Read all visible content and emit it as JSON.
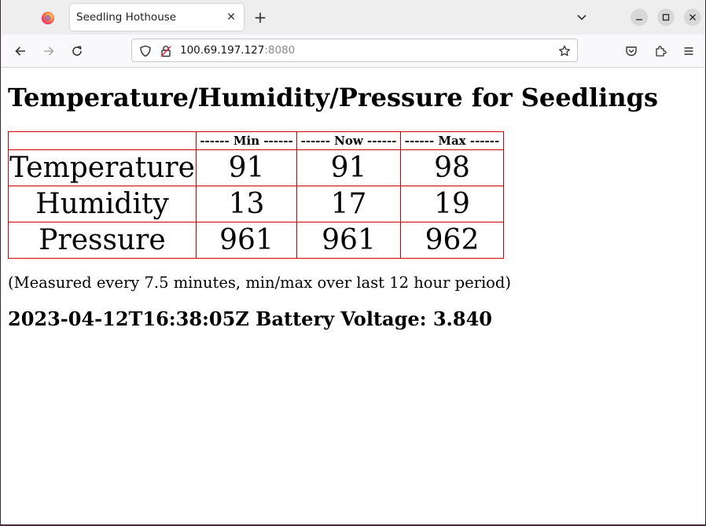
{
  "browser": {
    "tab_title": "Seedling Hothouse",
    "url_host": "100.69.197.127",
    "url_port": ":8080"
  },
  "page": {
    "title": "Temperature/Humidity/Pressure for Seedlings",
    "table": {
      "headers": [
        "",
        "------ Min ------",
        "------ Now ------",
        "------ Max ------"
      ],
      "rows": [
        {
          "label": "Temperature",
          "min": "91",
          "now": "91",
          "max": "98"
        },
        {
          "label": "Humidity",
          "min": "13",
          "now": "17",
          "max": "19"
        },
        {
          "label": "Pressure",
          "min": "961",
          "now": "961",
          "max": "962"
        }
      ]
    },
    "note": "(Measured every 7.5 minutes, min/max over last 12 hour period)",
    "status": "2023-04-12T16:38:05Z Battery Voltage: 3.840"
  },
  "colors": {
    "table_border": "#cc0000",
    "tabstrip_bg": "#eeeeee",
    "navbar_bg": "#f9f9fb"
  },
  "icons": [
    "firefox-icon",
    "close-icon",
    "plus-icon",
    "chevron-down-icon",
    "minimize-icon",
    "maximize-icon",
    "window-close-icon",
    "back-arrow-icon",
    "forward-arrow-icon",
    "reload-icon",
    "shield-icon",
    "insecure-lock-icon",
    "bookmark-star-icon",
    "pocket-icon",
    "extensions-icon",
    "hamburger-menu-icon"
  ]
}
